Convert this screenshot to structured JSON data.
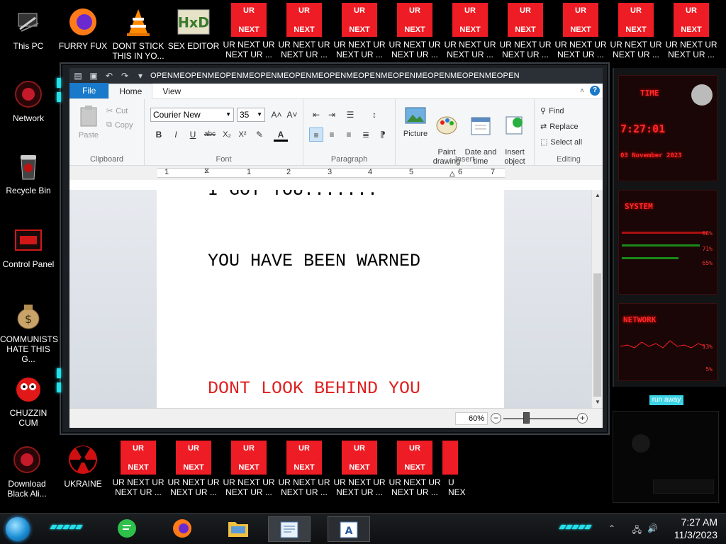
{
  "desktop": {
    "left_icons": [
      {
        "label": "This PC",
        "icon": "computer-icon"
      },
      {
        "label": "Network",
        "icon": "network-icon"
      },
      {
        "label": "Recycle Bin",
        "icon": "recycle-bin-icon"
      },
      {
        "label": "Control Panel",
        "icon": "control-panel-icon"
      },
      {
        "label": "COMMUNISTS\nHATE THIS G...",
        "icon": "money-bag-icon"
      },
      {
        "label": "CHUZZIN\nCUM",
        "icon": "red-furball-icon"
      },
      {
        "label": "Download\nBlack Ali...",
        "icon": "alien-icon"
      }
    ],
    "top_icons": [
      {
        "label": "FURRY FUX",
        "icon": "firefox-icon"
      },
      {
        "label": "DONT STICK\nTHIS IN YO...",
        "icon": "vlc-icon"
      },
      {
        "label": "SEX EDITOR",
        "icon": "hxd-icon"
      }
    ],
    "ur_icon": {
      "top_text": "UR",
      "bottom_text": "NEXT",
      "label": "UR NEXT UR\nNEXT UR ..."
    },
    "bottom_icons": [
      {
        "label": "UKRAINE",
        "icon": "radiation-icon"
      }
    ],
    "bottom_truncated_label": "U\nNEX"
  },
  "wordpad": {
    "title": "OPENMEOPENMEOPENMEOPENMEOPENMEOPENMEOPENMEOPENMEOPENMEOPENMEOPENMEO...",
    "tabs": {
      "file": "File",
      "home": "Home",
      "view": "View"
    },
    "help": "?",
    "clipboard": {
      "paste": "Paste",
      "cut": "Cut",
      "copy": "Copy",
      "group": "Clipboard"
    },
    "font": {
      "family": "Courier New",
      "size": "35",
      "group": "Font",
      "bold": "B",
      "italic": "I",
      "underline": "U",
      "strike": "abc",
      "sub": "X₂",
      "sup": "X²",
      "grow": "A˄",
      "shrink": "A˅",
      "color": "A"
    },
    "paragraph": {
      "group": "Paragraph"
    },
    "insert": {
      "picture": "Picture",
      "paint": "Paint\ndrawing",
      "datetime": "Date and\ntime",
      "object": "Insert\nobject",
      "group": "Insert"
    },
    "editing": {
      "find": "Find",
      "replace": "Replace",
      "select_all": "Select all",
      "group": "Editing"
    },
    "ruler_numbers": [
      "1",
      "1",
      "2",
      "3",
      "4",
      "5",
      "6",
      "7"
    ],
    "document": {
      "line1": "I GOT YOU.......",
      "line2": "YOU HAVE BEEN WARNED",
      "line3": "DONT LOOK BEHIND YOU",
      "line3_color": "#e02020"
    },
    "zoom": "60%",
    "zoom_level": 0.6
  },
  "widget": {
    "time_label": "TIME",
    "clock": "7:27:01",
    "date": "03 November 2023",
    "system_label": "SYSTEM",
    "system_pcts": [
      "68%",
      "71%",
      "65%"
    ],
    "network_label": "NETWORK",
    "network_pcts": [
      "13%",
      "5%"
    ],
    "run_away": "run away",
    "accent": "#ff2020"
  },
  "taskbar": {
    "time": "7:27 AM",
    "date": "11/3/2023",
    "accent": "#23e0ea"
  }
}
